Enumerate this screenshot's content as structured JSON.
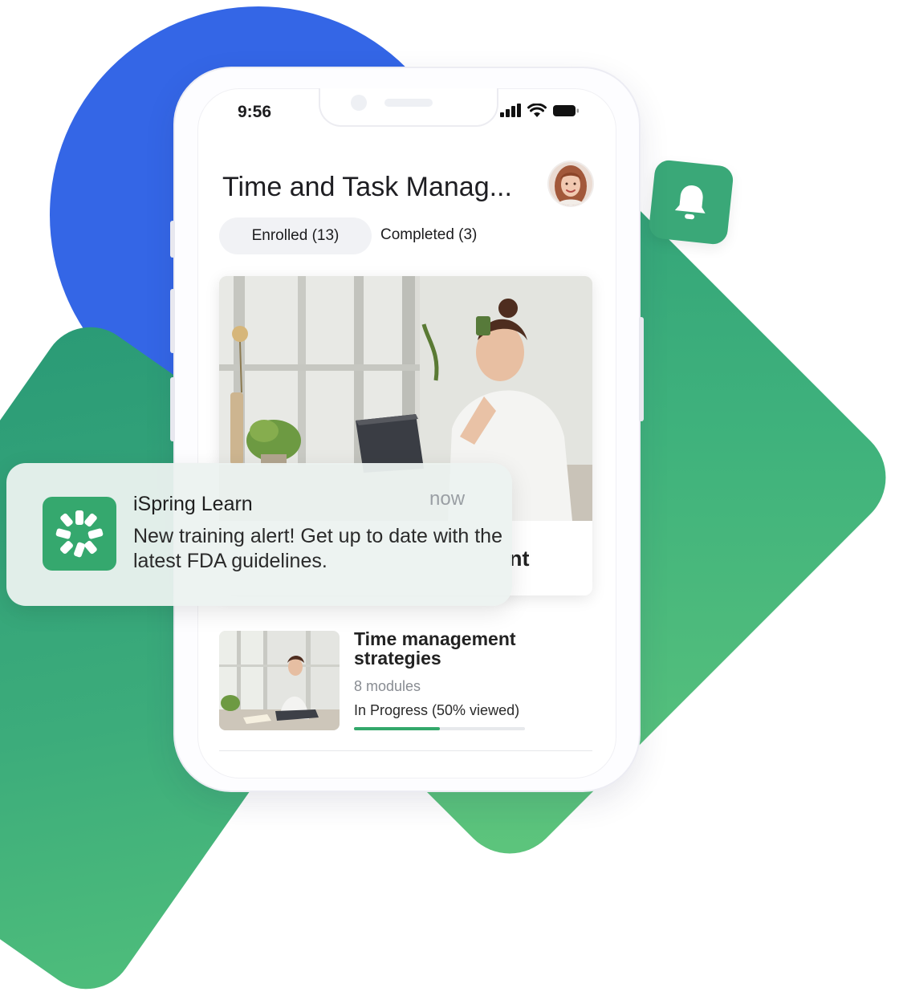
{
  "status_bar": {
    "time": "9:56"
  },
  "page": {
    "title": "Time and Task Manag..."
  },
  "tabs": [
    {
      "label": "Enrolled (13)",
      "active": true
    },
    {
      "label": "Completed (3)",
      "active": false
    }
  ],
  "hero_card": {
    "visible_title_fragment": "nt"
  },
  "notification": {
    "app": "iSpring Learn",
    "time": "now",
    "message": "New training alert! Get up to date with the latest FDA guidelines."
  },
  "course_item": {
    "title": "Time management strategies",
    "modules": "8 modules",
    "status": "In Progress (50% viewed)",
    "progress": 0.5
  },
  "colors": {
    "accent_green": "#33a86b",
    "brand_blue": "#3466e6",
    "badge_green": "#3aa878"
  },
  "icons": {
    "badge": "bell-icon",
    "notification": "ispring-logo-icon",
    "status": [
      "cellular-signal-icon",
      "wifi-icon",
      "battery-icon"
    ]
  }
}
